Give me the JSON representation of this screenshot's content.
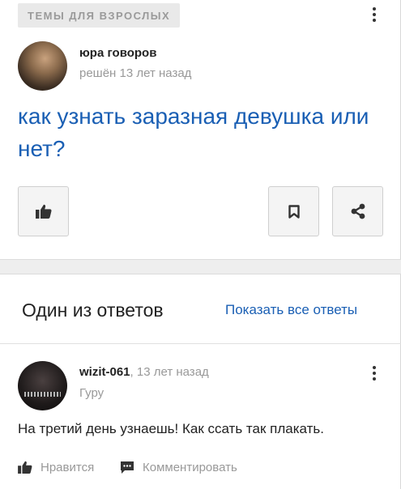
{
  "question": {
    "category": "ТЕМЫ ДЛЯ ВЗРОСЛЫХ",
    "author": "юра говоров",
    "meta": "решён 13 лет назад",
    "title": "как узнать заразная девушка или нет?"
  },
  "answers_section": {
    "heading": "Один из ответов",
    "show_all": "Показать все ответы"
  },
  "answer": {
    "author": "wizit-061",
    "time": ", 13 лет назад",
    "rank": "Гуру",
    "text": "На третий день узнаешь! Как ссать так плакать.",
    "like_label": "Нравится",
    "comment_label": "Комментировать"
  },
  "icons": {
    "like": "thumbs-up-icon",
    "bookmark": "bookmark-icon",
    "share": "share-icon",
    "comment": "comment-icon",
    "more": "more-vertical-icon"
  },
  "colors": {
    "link": "#1a5fb4",
    "muted": "#999999",
    "tag_bg": "#e9e9e9"
  }
}
